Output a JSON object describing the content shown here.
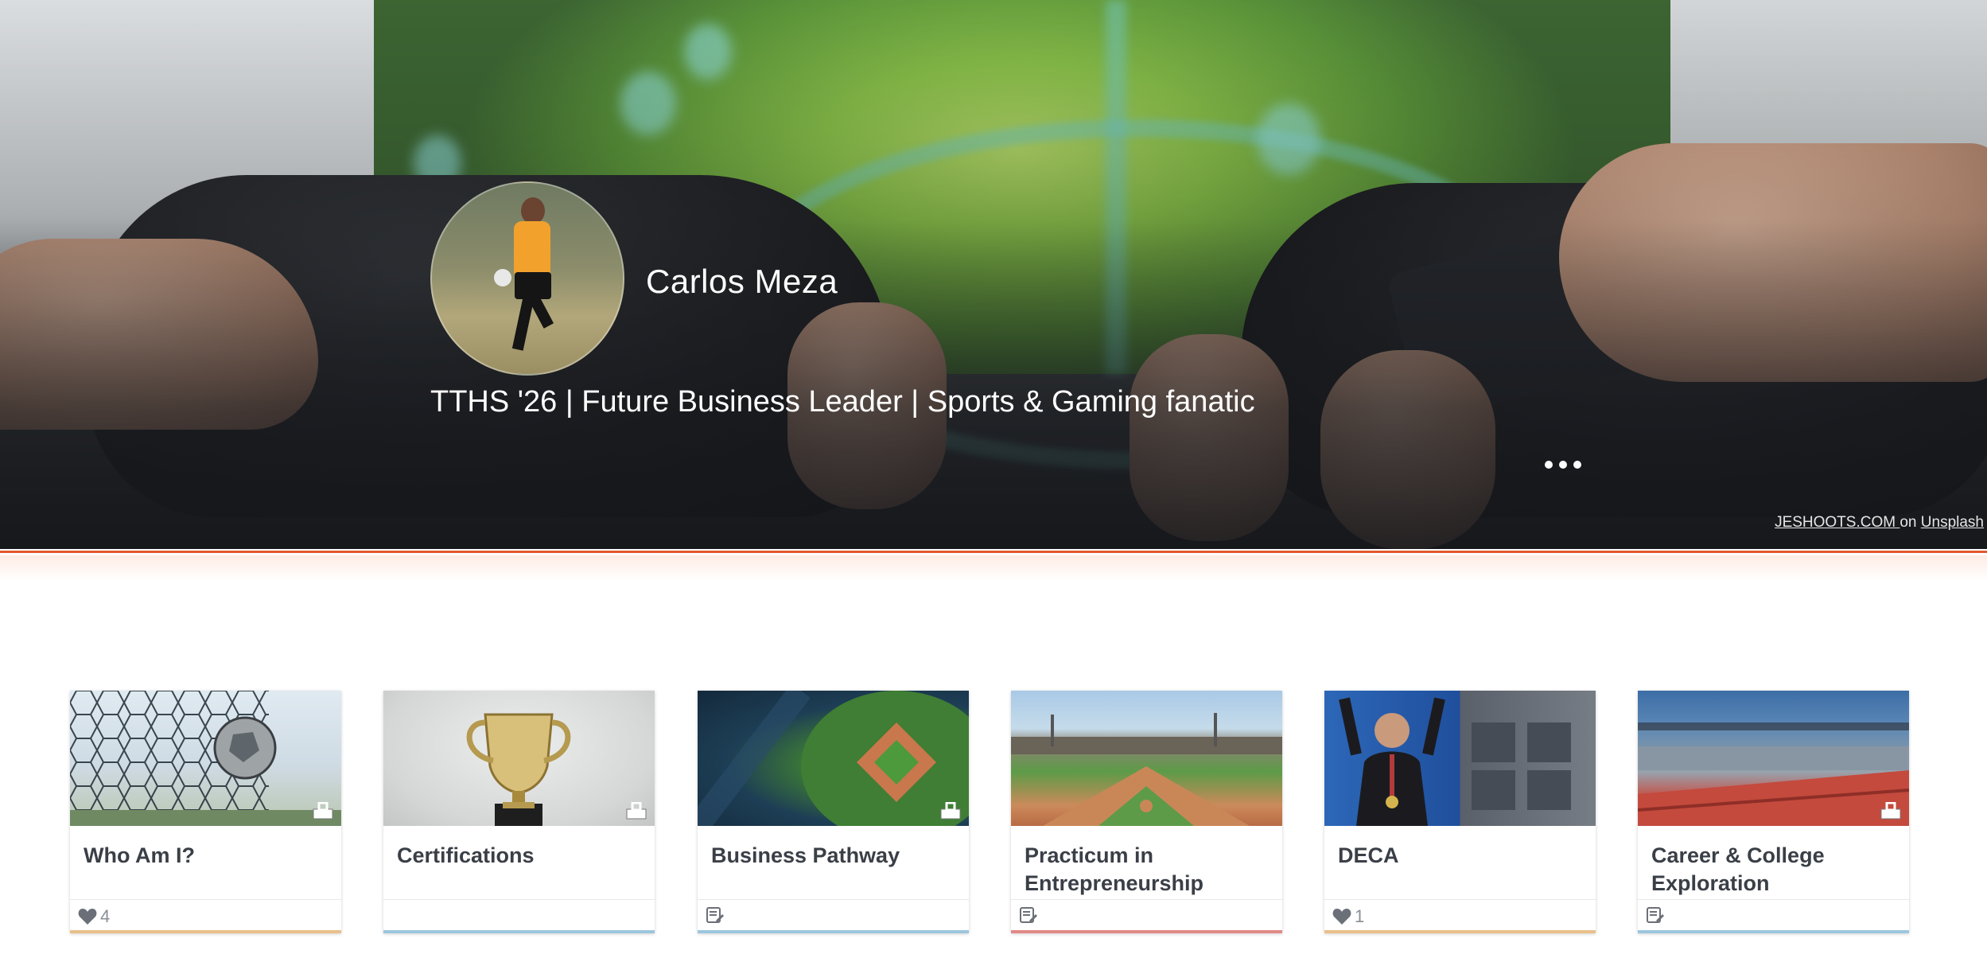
{
  "profile": {
    "name": "Carlos Meza",
    "tagline": "TTHS '26 | Future Business Leader | Sports & Gaming fanatic"
  },
  "hero": {
    "credit_author": "JESHOOTS.COM ",
    "credit_on": "on",
    "credit_source": "Unsplash",
    "more_icon": "more-horizontal-icon"
  },
  "colors": {
    "accent": "#e2572c",
    "card_title": "#3a3f47",
    "stripe_orange": "#e8b87e",
    "stripe_blue": "#9cc6dd",
    "stripe_red": "#e08a86"
  },
  "cards": [
    {
      "title": "Who Am I?",
      "footer_icon": "heart-icon",
      "likes": "4",
      "stripe": "#e8c08a"
    },
    {
      "title": "Certifications",
      "footer_icon": "",
      "likes": "",
      "stripe": "#9cc6dd"
    },
    {
      "title": "Business Pathway",
      "footer_icon": "document-edit-icon",
      "likes": "",
      "stripe": "#9cc6dd"
    },
    {
      "title": "Practicum in Entrepreneurship",
      "footer_icon": "document-edit-icon",
      "likes": "",
      "stripe": "#e08a86"
    },
    {
      "title": "DECA",
      "footer_icon": "heart-icon",
      "likes": "1",
      "stripe": "#e8c08a"
    },
    {
      "title": "Career & College Exploration",
      "footer_icon": "document-edit-icon",
      "likes": "",
      "stripe": "#9cc6dd"
    }
  ]
}
